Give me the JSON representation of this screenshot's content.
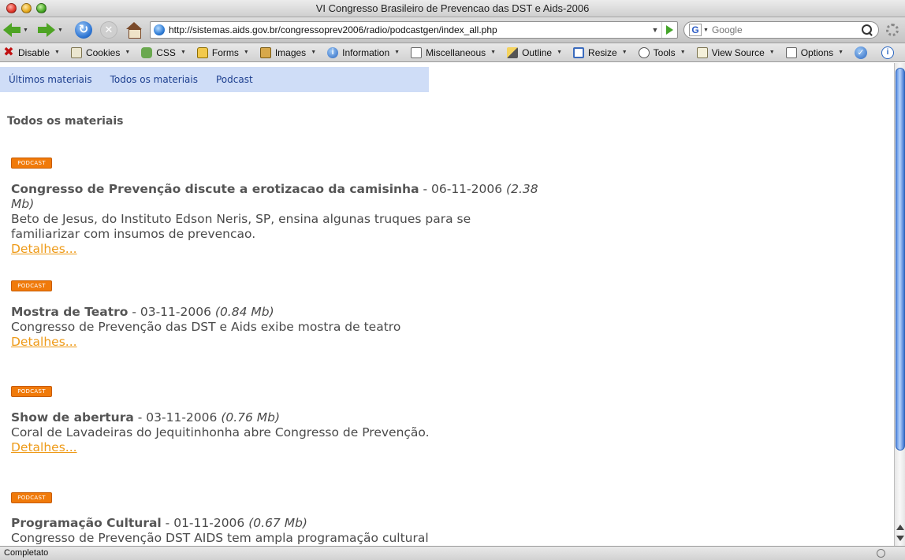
{
  "window": {
    "title": "VI Congresso Brasileiro de Prevencao das DST e Aids-2006"
  },
  "nav": {
    "url": "http://sistemas.aids.gov.br/congressoprev2006/radio/podcastgen/index_all.php",
    "search_placeholder": "Google",
    "search_engine_letter": "G"
  },
  "devbar": {
    "items": [
      {
        "label": "Disable",
        "icon": "disable-icon"
      },
      {
        "label": "Cookies",
        "icon": "cookie-icon"
      },
      {
        "label": "CSS",
        "icon": "css-icon"
      },
      {
        "label": "Forms",
        "icon": "lock-icon"
      },
      {
        "label": "Images",
        "icon": "images-icon"
      },
      {
        "label": "Information",
        "icon": "info-icon"
      },
      {
        "label": "Miscellaneous",
        "icon": "misc-icon"
      },
      {
        "label": "Outline",
        "icon": "pencil-icon"
      },
      {
        "label": "Resize",
        "icon": "resize-icon"
      },
      {
        "label": "Tools",
        "icon": "clock-icon"
      },
      {
        "label": "View Source",
        "icon": "source-icon"
      },
      {
        "label": "Options",
        "icon": "options-icon"
      }
    ]
  },
  "site_nav": {
    "items": [
      "Últimos materiais",
      "Todos os materiais",
      "Podcast"
    ]
  },
  "page": {
    "heading": "Todos os materiais",
    "badge_label": "PODCAST",
    "link_label": "Detalhes...",
    "separator": " - ",
    "entries": [
      {
        "title": "Congresso de Prevenção discute a erotizacao da camisinha",
        "date": "06-11-2006",
        "size": "(2.38 Mb)",
        "description": "Beto de Jesus, do Instituto Edson Neris, SP, ensina algunas truques para se familiarizar com insumos de prevencao."
      },
      {
        "title": "Mostra de Teatro",
        "date": "03-11-2006",
        "size": "(0.84 Mb)",
        "description": "Congresso de Prevenção das DST e Aids exibe mostra de teatro"
      },
      {
        "title": "Show de abertura",
        "date": "03-11-2006",
        "size": "(0.76 Mb)",
        "description": "Coral de Lavadeiras do Jequitinhonha abre Congresso de Prevenção."
      },
      {
        "title": "Programação Cultural",
        "date": "01-11-2006",
        "size": "(0.67 Mb)",
        "description": "Congresso de Prevenção DST AIDS tem ampla programação cultural"
      }
    ]
  },
  "status": {
    "text": "Completato"
  },
  "colors": {
    "badge": "#f07a0a",
    "link": "#ee9a17",
    "site_nav_bg": "#cfddf7"
  }
}
